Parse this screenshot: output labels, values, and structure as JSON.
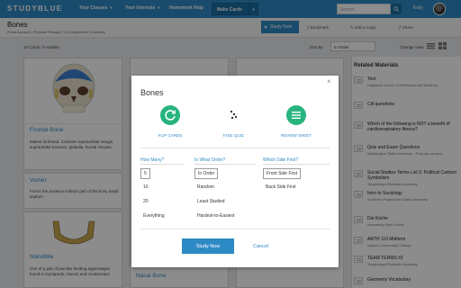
{
  "nav": {
    "logo": "STUDYBLUE",
    "links": [
      "Your Classes",
      "Your Interests",
      "Homework Help"
    ],
    "make_cards": "Make Cards",
    "search_placeholder": "Search",
    "username": "Kelly"
  },
  "deck": {
    "title": "Bones",
    "meta": "Press Account | Physical Therapy 710 | Marymount University",
    "study_now": "Study Now",
    "actions": [
      "Bookmark",
      "Edit a Copy",
      "Share"
    ]
  },
  "toolbar": {
    "cards_count": "15 Cards / 0 Hidden",
    "sort_by_label": "Sort By",
    "sort_value": "In Order",
    "change_view_label": "Change View"
  },
  "cards": [
    {
      "title": "Frontal Bone",
      "text": "Makes forehead. Contains supraorbital margin, supraorbital foramen, glabella, frontal sinuses"
    },
    {
      "title": "Vomer",
      "text": "Forms the posterior inferior part of the bony nasal septum"
    },
    {
      "title": "Mandible",
      "text": "One of a pair of jaw-like feeding appendages found in myriapods, insects and crustaceans"
    },
    {
      "title": "Nasal Bone",
      "text": ""
    }
  ],
  "sidebar": {
    "title": "Related Materials",
    "items": [
      {
        "title": "Test",
        "sub": "Hogwarts School of Witchcraft and Wizardry"
      },
      {
        "title": "Cilt questions",
        "sub": ""
      },
      {
        "title": "Which of the following is NOT a benefit of cardiorespiratory fitness?",
        "sub": ""
      },
      {
        "title": "Quiz and Exam Questions",
        "sub": "Washington State University - Pullman campus"
      },
      {
        "title": "Social Studies Terms List 2: Political Cartoon Symbolism",
        "sub": "Toughnioga Riverside Academy"
      },
      {
        "title": "Intro to Sociology",
        "sub": "Southern Polytechnic State University"
      },
      {
        "title": "Die Küche",
        "sub": "Normandy High School"
      },
      {
        "title": "ARTH 110 Midterm",
        "sub": "Ivytech Community College"
      },
      {
        "title": "TEAM TERMS #2",
        "sub": "Toughnioga Riverside Academy"
      },
      {
        "title": "Geometry Vocabulary",
        "sub": ""
      }
    ]
  },
  "modal": {
    "title": "Bones",
    "close": "×",
    "modes": [
      {
        "label": "FLIP CARDS",
        "icon": "refresh-icon"
      },
      {
        "label": "TAKE QUIZ",
        "icon": "quiz-icon"
      },
      {
        "label": "REVIEW SHEET",
        "icon": "list-icon"
      }
    ],
    "how_many": {
      "label": "How Many?",
      "options": [
        "5",
        "10",
        "20",
        "Everything"
      ],
      "selected": "5"
    },
    "what_order": {
      "label": "In What Order?",
      "options": [
        "In Order",
        "Random",
        "Least Studied",
        "Hardest-to-Easiest"
      ],
      "selected": "In Order"
    },
    "which_side": {
      "label": "Which Side First?",
      "options": [
        "Front Side First",
        "Back Side First"
      ],
      "selected": "Front Side First"
    },
    "study_button": "Study Now",
    "cancel": "Cancel"
  },
  "colors": {
    "accent": "#2e8ac5",
    "mode_green": "#27b47e",
    "nav": "#2e8ac5"
  }
}
